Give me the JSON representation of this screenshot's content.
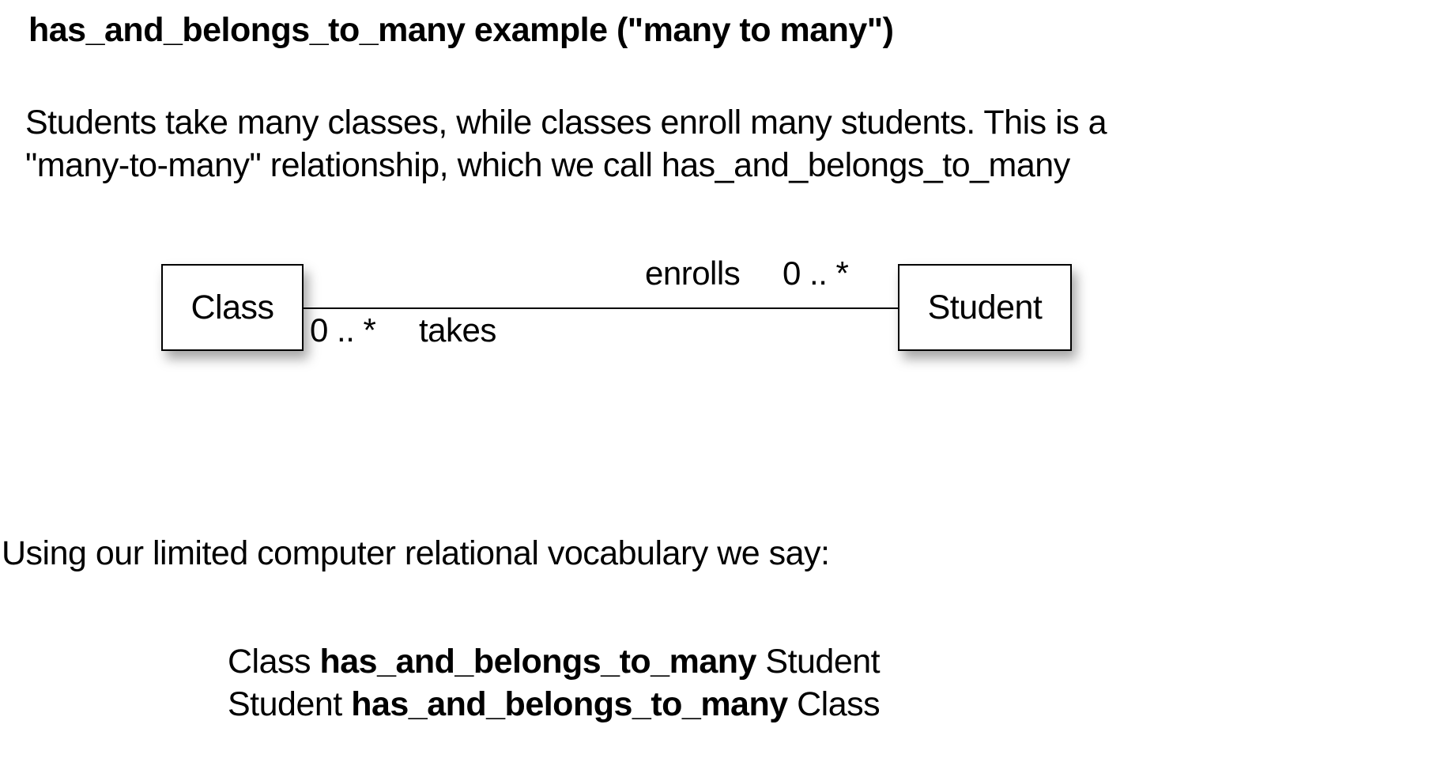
{
  "title": "has_and_belongs_to_many example  (\"many to many\")",
  "intro": "Students take many classes, while classes enroll many students.  This is a\n\"many-to-many\" relationship, which we call has_and_belongs_to_many",
  "diagram": {
    "leftEntity": "Class",
    "rightEntity": "Student",
    "topRole": "enrolls",
    "topMultiplicity": "0 .. *",
    "bottomMultiplicity": "0 .. *",
    "bottomRole": "takes"
  },
  "vocabIntro": "Using our limited computer relational vocabulary we say:",
  "vocabLines": [
    {
      "left": "Class ",
      "bold": "has_and_belongs_to_many",
      "right": " Student"
    },
    {
      "left": "Student ",
      "bold": "has_and_belongs_to_many",
      "right": " Class"
    }
  ]
}
